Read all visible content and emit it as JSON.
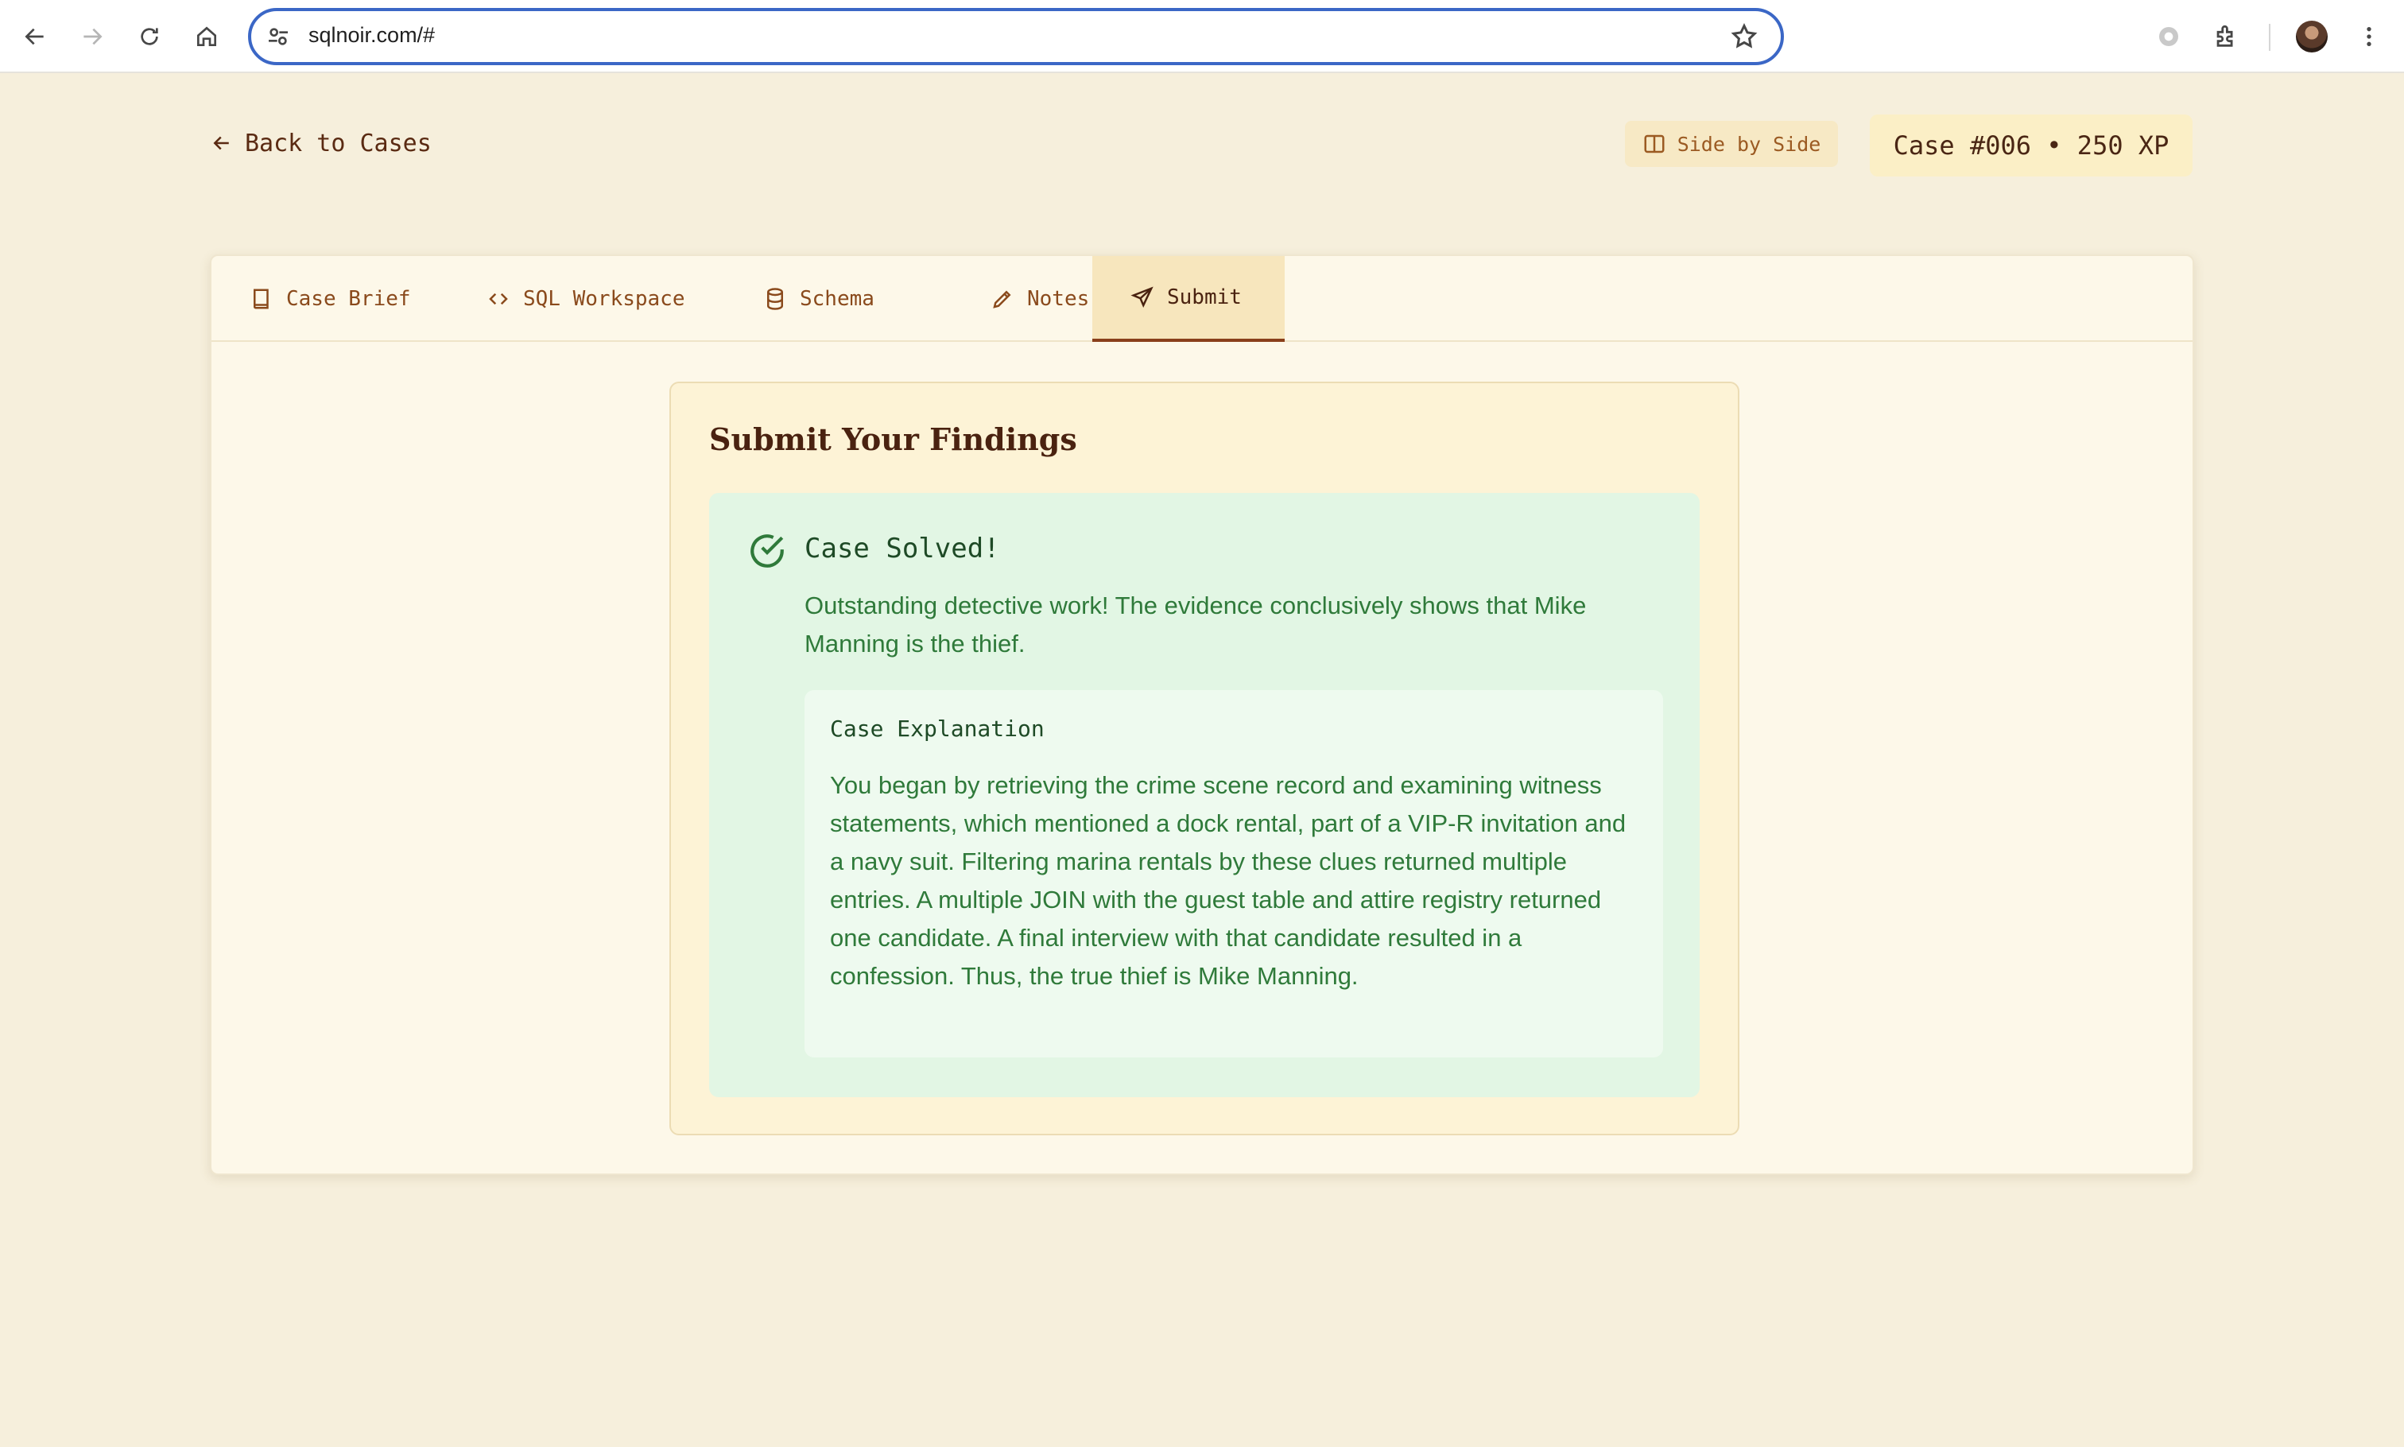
{
  "browser": {
    "url": "sqlnoir.com/#",
    "icons": [
      "back-arrow-icon",
      "forward-arrow-icon",
      "reload-icon",
      "home-icon",
      "site-settings-icon",
      "bookmark-star-icon",
      "extension-icon",
      "puzzle-icon",
      "avatar",
      "more-vert-icon"
    ]
  },
  "header": {
    "back_label": "Back to Cases",
    "side_by_side_label": "Side by Side",
    "case_badge": "Case #006 • 250 XP"
  },
  "tabs": [
    {
      "label": "Case Brief",
      "icon": "book-icon",
      "active": false
    },
    {
      "label": "SQL Workspace",
      "icon": "code-icon",
      "active": false
    },
    {
      "label": "Schema",
      "icon": "database-icon",
      "active": false
    },
    {
      "label": "Notes",
      "icon": "pencil-icon",
      "active": false
    },
    {
      "label": "Submit",
      "icon": "send-icon",
      "active": true
    }
  ],
  "findings": {
    "title": "Submit Your Findings",
    "solved_title": "Case Solved!",
    "solved_message": "Outstanding detective work! The evidence conclusively shows that Mike Manning is the thief.",
    "explanation_title": "Case Explanation",
    "explanation_text": "You began by retrieving the crime scene record and examining witness statements, which mentioned a dock rental, part of a VIP-R invitation and a navy suit. Filtering marina rentals by these clues returned multiple entries. A multiple JOIN with the guest table and attire registry returned one candidate. A final interview with that candidate resulted in a confession. Thus, the true thief is Mike Manning."
  },
  "colors": {
    "page_bg": "#f6efdc",
    "accent_brown": "#8a3f1a",
    "success_green": "#2f7a3a",
    "success_bg": "#e2f6e4"
  }
}
